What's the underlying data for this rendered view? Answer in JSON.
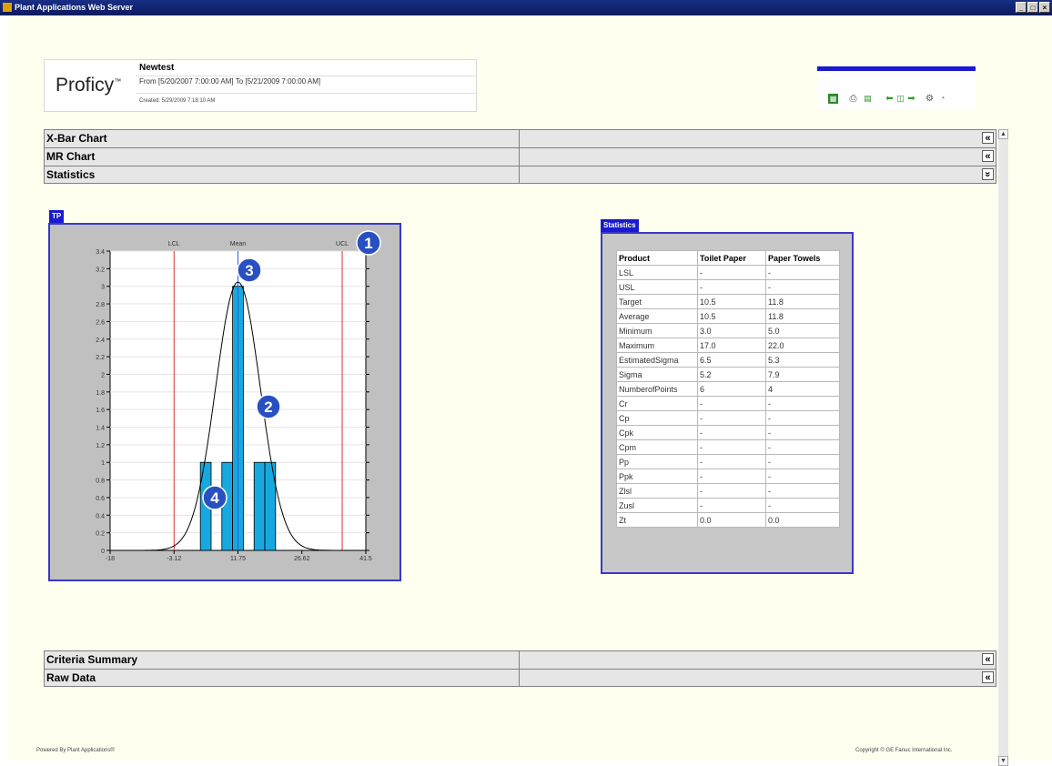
{
  "window": {
    "title": "Plant Applications Web Server",
    "buttons": [
      "_",
      "□",
      "×"
    ]
  },
  "report": {
    "logo": "Proficy",
    "logo_tm": "™",
    "title": "Newtest",
    "range": "From [5/20/2007 7:00:00 AM] To [5/21/2009 7:00:00 AM]",
    "created": "Created: 5/29/2009 7:18:10 AM"
  },
  "toolbar": {
    "icons": [
      "excel-icon",
      "print-icon",
      "export-icon",
      "back-icon",
      "calendar-icon",
      "forward-icon",
      "settings-icon",
      "help-icon"
    ],
    "accent": "#1a1ad0"
  },
  "sections_top": [
    {
      "label": "X-Bar Chart",
      "toggle": "«"
    },
    {
      "label": "MR Chart",
      "toggle": "«"
    },
    {
      "label": "Statistics",
      "toggle": "»"
    }
  ],
  "chart_tab": "TP",
  "stats_tab": "Statistics",
  "chart_data": {
    "type": "bar",
    "series_name": "TP",
    "ref_lines": [
      {
        "label": "LCL",
        "x": -3.12
      },
      {
        "label": "Mean",
        "x": 11.75
      },
      {
        "label": "UCL",
        "x": 36.0
      }
    ],
    "x_ticks": [
      "-18",
      "-3.12",
      "11.75",
      "26.62",
      "41.5"
    ],
    "xlim": [
      -18,
      41.5
    ],
    "y_ticks": [
      "0",
      "0.2",
      "0.4",
      "0.6",
      "0.8",
      "1",
      "1.2",
      "1.4",
      "1.6",
      "1.8",
      "2",
      "2.2",
      "2.4",
      "2.6",
      "2.8",
      "3",
      "3.2",
      "3.4"
    ],
    "ylim": [
      0,
      3.4
    ],
    "bars": [
      {
        "x0": 3.0,
        "x1": 5.5,
        "y": 1
      },
      {
        "x0": 8.0,
        "x1": 10.5,
        "y": 1
      },
      {
        "x0": 10.5,
        "x1": 13.0,
        "y": 3
      },
      {
        "x0": 15.5,
        "x1": 18.0,
        "y": 1
      },
      {
        "x0": 18.0,
        "x1": 20.5,
        "y": 1
      }
    ],
    "curve": {
      "mean": 11.75,
      "peak": 3.05,
      "sigma": 5.2
    },
    "callouts": [
      "1",
      "2",
      "3",
      "4"
    ],
    "colors": {
      "bar": "#18a8e0",
      "bar_stroke": "#000000",
      "limit": "#e03030",
      "mean": "#3060e0",
      "curve": "#000000",
      "callout": "#2850c0"
    }
  },
  "stats": {
    "headers": [
      "Product",
      "Toilet Paper",
      "Paper Towels"
    ],
    "rows": [
      [
        "LSL",
        "-",
        "-"
      ],
      [
        "USL",
        "-",
        "-"
      ],
      [
        "Target",
        "10.5",
        "11.8"
      ],
      [
        "Average",
        "10.5",
        "11.8"
      ],
      [
        "Minimum",
        "3.0",
        "5.0"
      ],
      [
        "Maximum",
        "17.0",
        "22.0"
      ],
      [
        "EstimatedSigma",
        "6.5",
        "5.3"
      ],
      [
        "Sigma",
        "5.2",
        "7.9"
      ],
      [
        "NumberofPoints",
        "6",
        "4"
      ],
      [
        "Cr",
        "-",
        "-"
      ],
      [
        "Cp",
        "-",
        "-"
      ],
      [
        "Cpk",
        "-",
        "-"
      ],
      [
        "Cpm",
        "-",
        "-"
      ],
      [
        "Pp",
        "-",
        "-"
      ],
      [
        "Ppk",
        "-",
        "-"
      ],
      [
        "Zlsl",
        "-",
        "-"
      ],
      [
        "Zusl",
        "-",
        "-"
      ],
      [
        "Zt",
        "0.0",
        "0.0"
      ]
    ]
  },
  "sections_bottom": [
    {
      "label": "Criteria Summary",
      "toggle": "«"
    },
    {
      "label": "Raw Data",
      "toggle": "«"
    }
  ],
  "footer": {
    "left": "Powered By Plant Applications®",
    "right": "Copyright © GE Fanuc International Inc."
  }
}
